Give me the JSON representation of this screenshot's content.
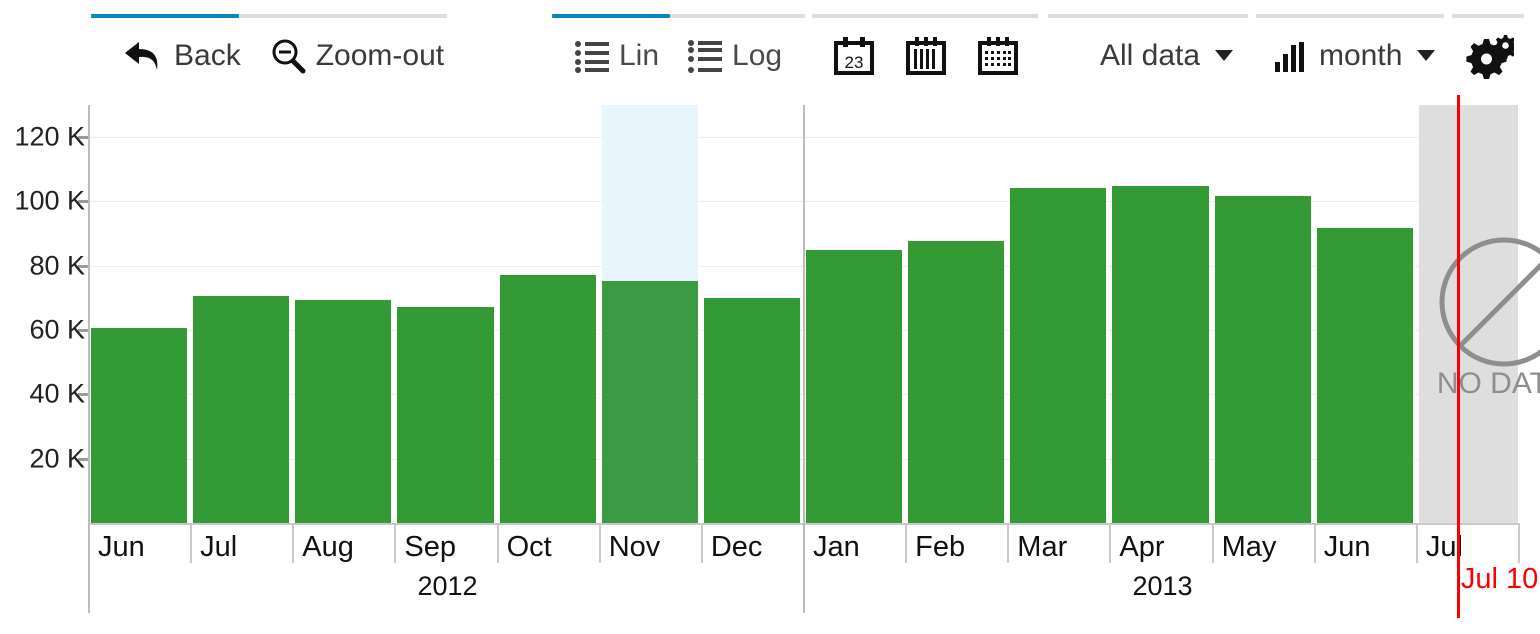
{
  "toolbar": {
    "groups": [
      {
        "name": "navigation",
        "active_index": 0,
        "items": [
          {
            "label": "Back",
            "icon": "back-arrow-icon",
            "active": true
          },
          {
            "label": "Zoom-out",
            "icon": "zoom-out-icon",
            "active": false
          }
        ]
      },
      {
        "name": "scale",
        "active_index": 0,
        "items": [
          {
            "label": "Lin",
            "icon": "list-lin-icon",
            "active": true
          },
          {
            "label": "Log",
            "icon": "list-log-icon",
            "active": false
          }
        ]
      },
      {
        "name": "calendar-views",
        "items": [
          {
            "label": "",
            "icon": "calendar-day-icon",
            "active": false
          },
          {
            "label": "",
            "icon": "calendar-bars-icon",
            "active": false
          },
          {
            "label": "",
            "icon": "calendar-grid-icon",
            "active": false
          }
        ]
      },
      {
        "name": "data-range",
        "items": [
          {
            "label": "All data",
            "icon": "",
            "dropdown": true
          }
        ]
      },
      {
        "name": "granularity",
        "items": [
          {
            "label": "month",
            "icon": "bar-chart-icon",
            "dropdown": true
          }
        ]
      },
      {
        "name": "settings",
        "items": [
          {
            "label": "",
            "icon": "gears-icon"
          }
        ]
      }
    ]
  },
  "chart_data": {
    "type": "bar",
    "title": "",
    "xlabel": "",
    "ylabel": "",
    "ylim": [
      0,
      130000
    ],
    "grid": true,
    "legend": null,
    "y_ticks": [
      20000,
      40000,
      60000,
      80000,
      100000,
      120000
    ],
    "y_tick_labels": [
      "20 K",
      "40 K",
      "60 K",
      "80 K",
      "100 K",
      "120 K"
    ],
    "categories": [
      "Jun",
      "Jul",
      "Aug",
      "Sep",
      "Oct",
      "Nov",
      "Dec",
      "Jan",
      "Feb",
      "Mar",
      "Apr",
      "May",
      "Jun",
      "Jul"
    ],
    "values": [
      60500,
      70500,
      69300,
      67300,
      77000,
      75300,
      70000,
      84800,
      87600,
      104200,
      104800,
      101800,
      91600,
      null
    ],
    "year_groups": [
      {
        "label": "2012",
        "start_index": 0,
        "end_index": 6
      },
      {
        "label": "2013",
        "start_index": 7,
        "end_index": 13
      }
    ],
    "highlighted_index": 5,
    "no_data_index": 13,
    "no_data_label": "NO DATA",
    "marker": {
      "label": "Jul 10",
      "category_index": 13,
      "color": "#fb0000"
    },
    "bar_color": "#349a35",
    "bar_color_highlight": "#3d9a44",
    "highlight_band_color": "#e9f5fc",
    "no_data_color": "#dedede"
  }
}
